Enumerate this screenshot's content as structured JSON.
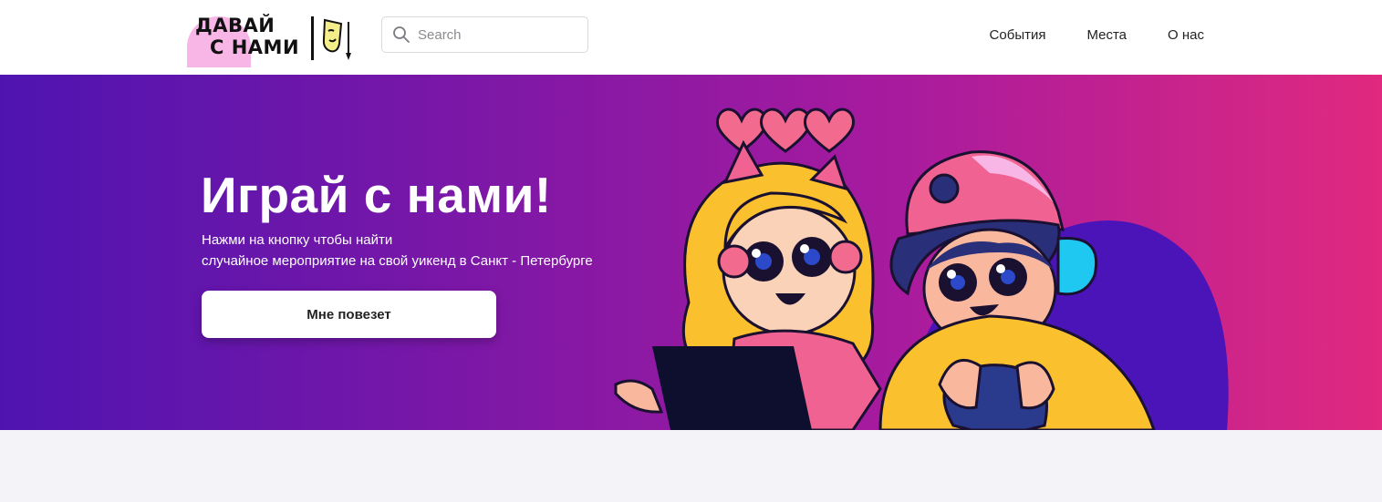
{
  "header": {
    "logo_line1": "ДАВАЙ",
    "logo_line2": "С НАМИ",
    "search_placeholder": "Search",
    "nav": [
      {
        "label": "События"
      },
      {
        "label": "Места"
      },
      {
        "label": "О нас"
      }
    ]
  },
  "hero": {
    "title": "Играй с нами!",
    "subtitle_line1": "Нажми на кнопку чтобы найти",
    "subtitle_line2": "случайное мероприятие на свой уикенд в Санкт - Петербурге",
    "button_label": "Мне повезет"
  },
  "colors": {
    "hero_gradient_start": "#4f14b0",
    "hero_gradient_end": "#e0297f",
    "logo_blob": "#f7b6e6",
    "page_bg": "#f4f4f8"
  },
  "icons": {
    "search": "search-icon",
    "logo_mark": "theater-mask-icon"
  }
}
